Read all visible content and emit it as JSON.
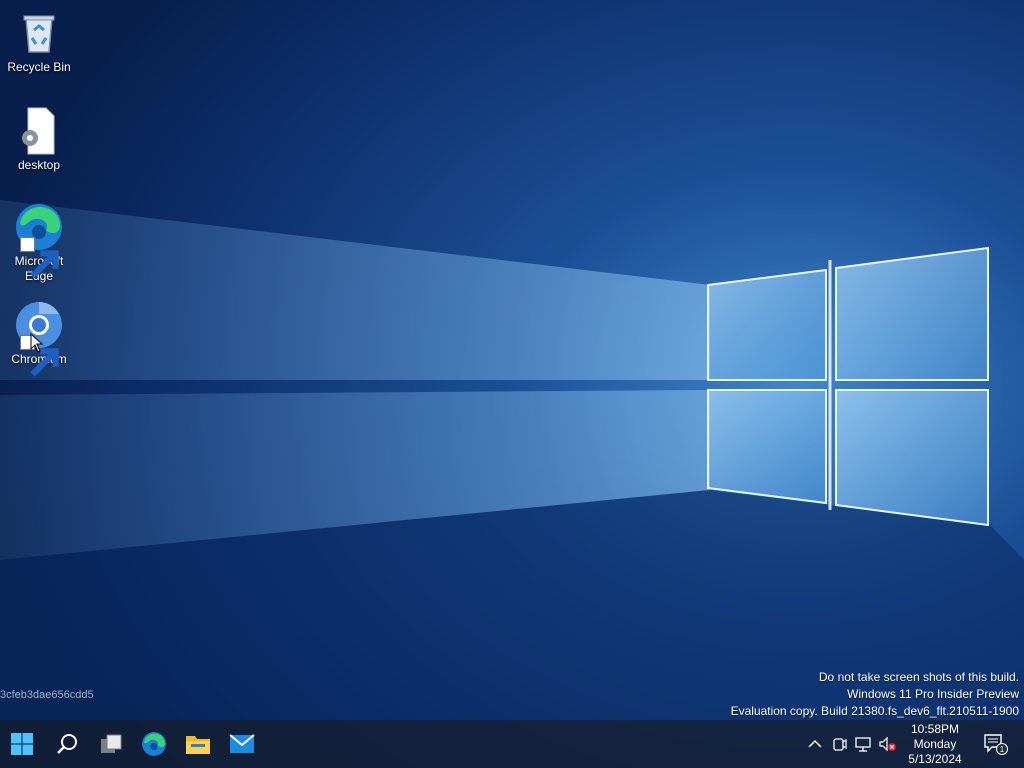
{
  "desktop": {
    "icons": [
      {
        "label": "Recycle Bin",
        "icon": "recycle-bin-icon"
      },
      {
        "label": "desktop",
        "icon": "settings-file-icon"
      },
      {
        "label": "Microsoft Edge",
        "icon": "edge-icon"
      },
      {
        "label": "Chromium",
        "icon": "chromium-icon"
      }
    ],
    "hash_label": "3cfeb3dae656cdd5"
  },
  "watermark": {
    "line1": "Do not take screen shots of this build.",
    "line2": "Windows 11 Pro Insider Preview",
    "line3": "Evaluation copy. Build 21380.fs_dev6_flt.210511-1900"
  },
  "taskbar": {
    "buttons": [
      {
        "icon": "windows-start-icon"
      },
      {
        "icon": "search-icon"
      },
      {
        "icon": "task-view-icon"
      },
      {
        "icon": "edge-icon"
      },
      {
        "icon": "file-explorer-icon"
      },
      {
        "icon": "mail-icon"
      }
    ],
    "tray": [
      "chevron-up-icon",
      "meet-now-icon",
      "network-icon",
      "volume-muted-icon"
    ],
    "clock": {
      "time": "10:58PM",
      "day": "Monday",
      "date": "5/13/2024"
    },
    "notification_count": "1"
  },
  "colors": {
    "accent": "#0078d4",
    "taskbar": "#141e32",
    "wallpaper": "#0b2a66"
  }
}
